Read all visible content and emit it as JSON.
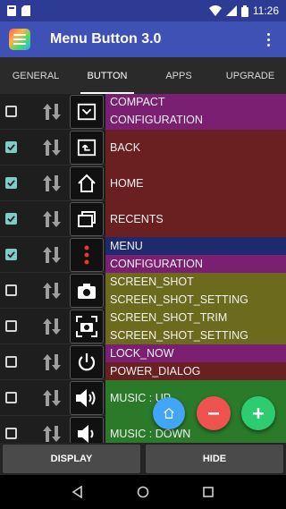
{
  "status": {
    "time": "11:26"
  },
  "app": {
    "title": "Menu Button 3.0"
  },
  "tabs": [
    {
      "label": "GENERAL"
    },
    {
      "label": "BUTTON"
    },
    {
      "label": "APPS"
    },
    {
      "label": "UPGRADE"
    }
  ],
  "active_tab": "BUTTON",
  "rows": [
    {
      "checked": false,
      "icon": "compact-icon",
      "lines": [
        "COMPACT",
        "CONFIGURATION"
      ]
    },
    {
      "checked": true,
      "icon": "back-icon",
      "lines": [
        "BACK"
      ]
    },
    {
      "checked": true,
      "icon": "home-icon",
      "lines": [
        "HOME"
      ]
    },
    {
      "checked": true,
      "icon": "recents-icon",
      "lines": [
        "RECENTS"
      ]
    },
    {
      "checked": true,
      "icon": "menu-dots-icon",
      "lines": [
        "MENU",
        "CONFIGURATION"
      ]
    },
    {
      "checked": false,
      "icon": "camera-icon",
      "lines": [
        "SCREEN_SHOT",
        "SCREEN_SHOT_SETTING"
      ]
    },
    {
      "checked": false,
      "icon": "camera-trim-icon",
      "lines": [
        "SCREEN_SHOT_TRIM",
        "SCREEN_SHOT_SETTING"
      ]
    },
    {
      "checked": false,
      "icon": "power-icon",
      "lines": [
        "LOCK_NOW",
        "POWER_DIALOG"
      ]
    },
    {
      "checked": false,
      "icon": "volume-up-icon",
      "lines": [
        "MUSIC : UP"
      ]
    },
    {
      "checked": false,
      "icon": "volume-down-icon",
      "lines": [
        "MUSIC : DOWN"
      ]
    }
  ],
  "buttons": {
    "display": "DISPLAY",
    "hide": "HIDE"
  },
  "colors": {
    "toolbar": "#3f51b5",
    "statusbar": "#2e3b94",
    "checkbox_on": "#80cbc4",
    "fab_home": "#42a5f5",
    "fab_remove": "#ef5350",
    "fab_add": "#2ecc71"
  }
}
